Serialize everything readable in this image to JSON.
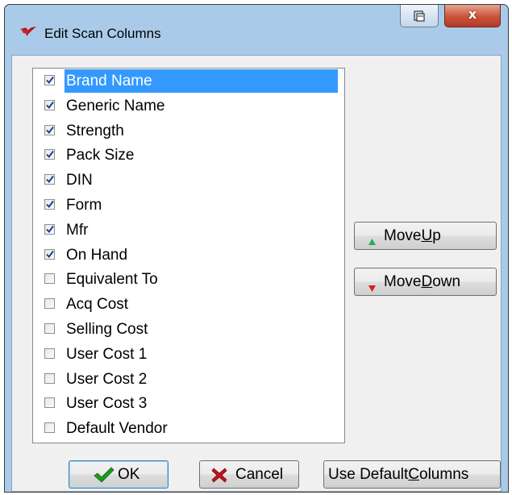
{
  "window": {
    "title": "Edit Scan Columns",
    "close_glyph": "x",
    "icons": [
      "app-logo-icon",
      "restore-icon",
      "close-icon"
    ]
  },
  "columns": [
    {
      "label": "Brand Name",
      "checked": true,
      "selected": true
    },
    {
      "label": "Generic Name",
      "checked": true,
      "selected": false
    },
    {
      "label": "Strength",
      "checked": true,
      "selected": false
    },
    {
      "label": "Pack Size",
      "checked": true,
      "selected": false
    },
    {
      "label": "DIN",
      "checked": true,
      "selected": false
    },
    {
      "label": "Form",
      "checked": true,
      "selected": false
    },
    {
      "label": "Mfr",
      "checked": true,
      "selected": false
    },
    {
      "label": "On Hand",
      "checked": true,
      "selected": false
    },
    {
      "label": "Equivalent To",
      "checked": false,
      "selected": false
    },
    {
      "label": "Acq Cost",
      "checked": false,
      "selected": false
    },
    {
      "label": "Selling Cost",
      "checked": false,
      "selected": false
    },
    {
      "label": "User Cost 1",
      "checked": false,
      "selected": false
    },
    {
      "label": "User Cost 2",
      "checked": false,
      "selected": false
    },
    {
      "label": "User Cost 3",
      "checked": false,
      "selected": false
    },
    {
      "label": "Default Vendor",
      "checked": false,
      "selected": false
    }
  ],
  "buttons": {
    "move_up": {
      "pre": "Move ",
      "key": "U",
      "post": "p"
    },
    "move_down": {
      "pre": "Move ",
      "key": "D",
      "post": "own"
    },
    "ok": {
      "label": "OK"
    },
    "cancel": {
      "label": "Cancel"
    },
    "defaults": {
      "pre": "Use Default ",
      "key": "C",
      "post": "olumns"
    }
  },
  "colors": {
    "frame": "#a9cbe9",
    "selection": "#3399ff",
    "up_arrow": "#22b14c",
    "down_arrow": "#e01b1b",
    "ok_check": "#1a9c1a",
    "cancel_x": "#c0141c"
  }
}
